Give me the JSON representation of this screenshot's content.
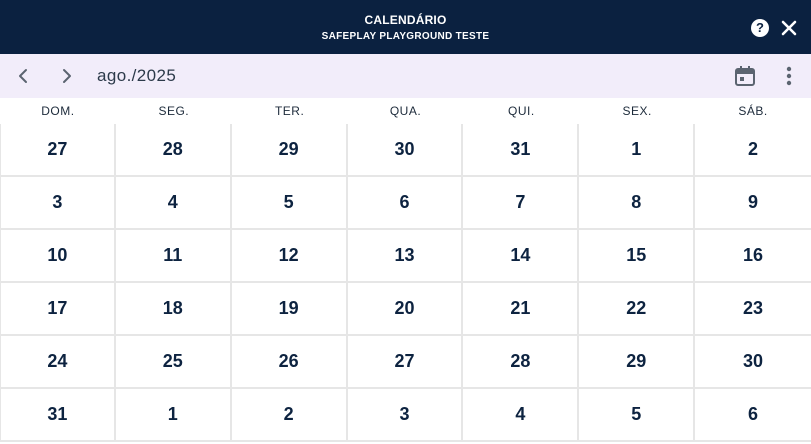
{
  "titlebar": {
    "title": "CALENDÁRIO",
    "subtitle": "SAFEPLAY PLAYGROUND TESTE",
    "help_label": "?",
    "background": "#0b2140"
  },
  "toolbar": {
    "month_label": "ago./2025",
    "prev_icon": "chevron-left-icon",
    "next_icon": "chevron-right-icon",
    "calendar_icon": "calendar-icon",
    "more_icon": "more-vert-icon",
    "background": "#f2edfa"
  },
  "weekdays": [
    "DOM.",
    "SEG.",
    "TER.",
    "QUA.",
    "QUI.",
    "SEX.",
    "SÁB."
  ],
  "weeks": [
    [
      "27",
      "28",
      "29",
      "30",
      "31",
      "1",
      "2"
    ],
    [
      "3",
      "4",
      "5",
      "6",
      "7",
      "8",
      "9"
    ],
    [
      "10",
      "11",
      "12",
      "13",
      "14",
      "15",
      "16"
    ],
    [
      "17",
      "18",
      "19",
      "20",
      "21",
      "22",
      "23"
    ],
    [
      "24",
      "25",
      "26",
      "27",
      "28",
      "29",
      "30"
    ],
    [
      "31",
      "1",
      "2",
      "3",
      "4",
      "5",
      "6"
    ]
  ]
}
